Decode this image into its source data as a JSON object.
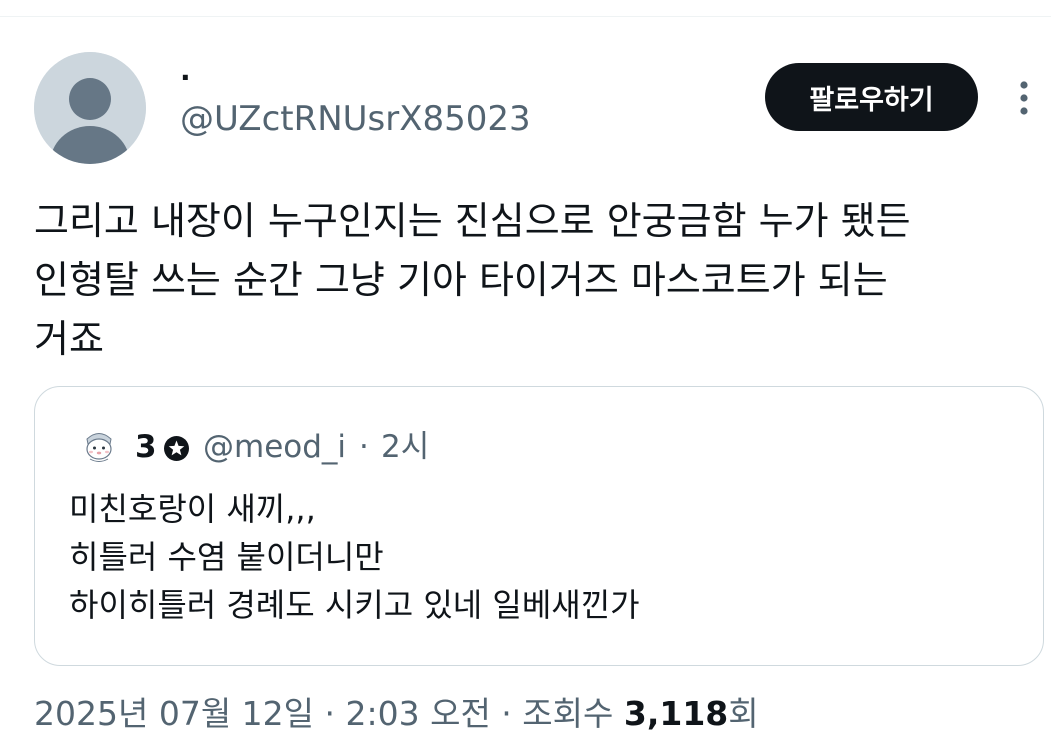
{
  "author": {
    "display_name": "·",
    "handle": "@UZctRNUsrX85023",
    "avatar_icon": "default-profile-icon"
  },
  "follow_button": {
    "label": "팔로우하기"
  },
  "more_icon": "more-vertical-icon",
  "tweet": {
    "text": "그리고 내장이 누구인지는 진심으로 안궁금함 누가 됐든\n인형탈 쓰는 순간 그냥 기아 타이거즈 마스코트가 되는\n거죠"
  },
  "quoted_tweet": {
    "avatar_icon": "cartoon-character-avatar-icon",
    "display_name": "3",
    "name_badge_icon": "star-circle-icon",
    "handle": "@meod_i",
    "separator": "·",
    "time": "2시",
    "text": "미친호랑이 새끼,,,\n히틀러 수염 붙이더니만\n하이히틀러 경례도 시키고 있네 일베새낀가"
  },
  "meta": {
    "date": "2025년 07월 12일 · 2:03 오전 · 조회수 ",
    "views_count": "3,118",
    "views_suffix": "회"
  },
  "colors": {
    "text_primary": "#0f1419",
    "text_secondary": "#536471",
    "border": "#cfd9de",
    "button_bg": "#0f1419",
    "avatar_bg": "#ccd6dd",
    "avatar_fg": "#657786"
  }
}
